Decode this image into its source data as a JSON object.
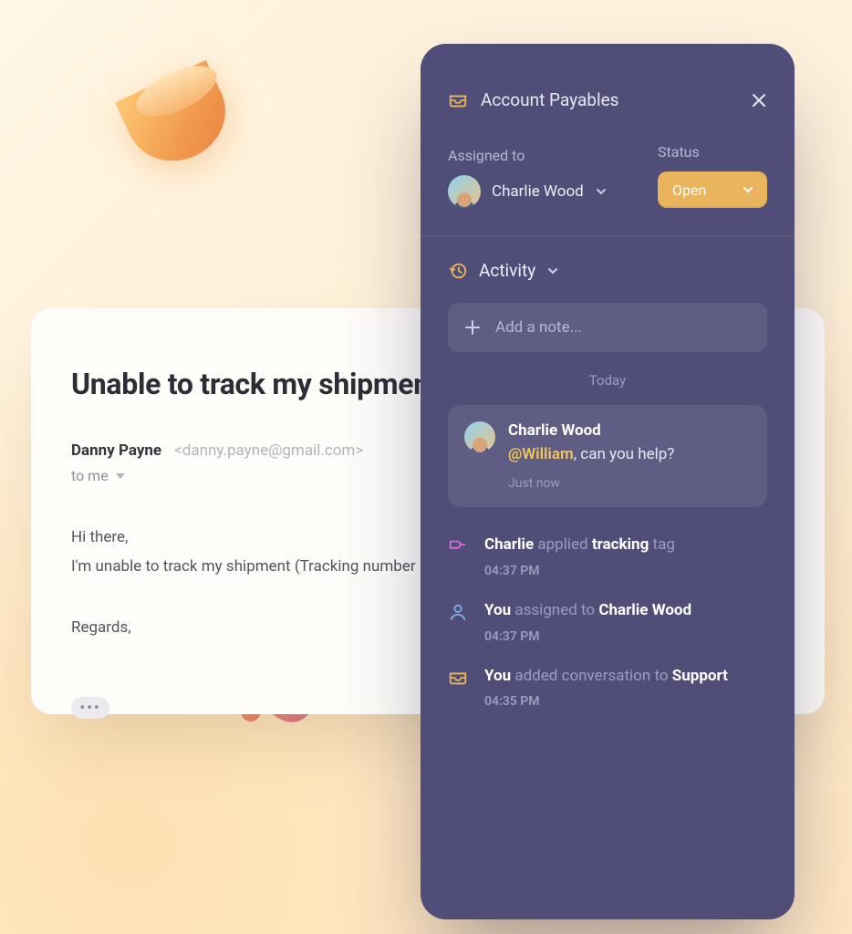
{
  "email": {
    "title": "Unable to track my shipment",
    "from_name": "Danny Payne",
    "from_email": "<danny.payne@gmail.com>",
    "to_line": "to me",
    "body_line1": "Hi there,",
    "body_line2": "I'm unable to track my shipment (Tracking number",
    "body_regards": "Regards,"
  },
  "panel": {
    "title": "Account Payables",
    "assigned_label": "Assigned to",
    "assignee": "Charlie Wood",
    "status_label": "Status",
    "status_value": "Open",
    "activity_label": "Activity",
    "note_placeholder": "Add a note...",
    "day": "Today",
    "note": {
      "author": "Charlie Wood",
      "mention": "@William",
      "rest": ", can you help?",
      "time": "Just now"
    },
    "feed": [
      {
        "icon": "tag",
        "actor": "Charlie",
        "verb": "applied",
        "object": "tracking",
        "suffix": "tag",
        "time": "04:37 PM"
      },
      {
        "icon": "person",
        "actor": "You",
        "verb": "assigned to",
        "object": "Charlie Wood",
        "suffix": "",
        "time": "04:37 PM"
      },
      {
        "icon": "inbox",
        "actor": "You",
        "verb": "added conversation to",
        "object": "Support",
        "suffix": "",
        "time": "04:35 PM"
      }
    ]
  },
  "colors": {
    "accent": "#e9b45b",
    "tag_icon": "#d86cd4",
    "person_icon": "#7faee9",
    "inbox_icon": "#e9b45b"
  }
}
